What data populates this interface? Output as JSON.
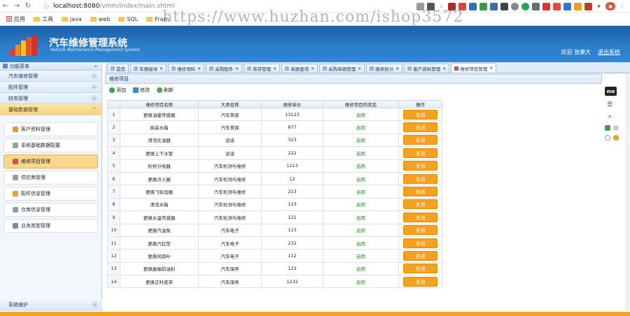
{
  "browser": {
    "url_host": "localhost:8080",
    "url_path": "/vmm/index/main.shtml",
    "bookmarks": [
      "应用",
      "工具",
      "java",
      "web",
      "SQL",
      "Fram"
    ]
  },
  "watermark": "https://www.huzhan.com/ishop3572",
  "header": {
    "title": "汽车维修管理系统",
    "subtitle": "Vehicle Maintenance Management System",
    "greeting": "欢迎 张康大",
    "logout": "退出系统",
    "brand_color": "#2a7fcd"
  },
  "sidebar": {
    "header": "功能菜单",
    "sections": [
      {
        "label": "汽车维修管理"
      },
      {
        "label": "配件管理"
      },
      {
        "label": "财务管理"
      },
      {
        "label": "基础数据管理"
      }
    ],
    "items": [
      {
        "label": "客户资料管理",
        "icon": "user-icon"
      },
      {
        "label": "系统基础数据配置",
        "icon": "config-icon"
      },
      {
        "label": "维修项目管理",
        "icon": "repair-icon"
      },
      {
        "label": "供应商管理",
        "icon": "supplier-icon"
      },
      {
        "label": "配件信息管理",
        "icon": "parts-icon"
      },
      {
        "label": "仓库信息管理",
        "icon": "warehouse-icon"
      },
      {
        "label": "业务类型管理",
        "icon": "business-icon"
      }
    ],
    "bottom_section": "系统维护"
  },
  "tabs": [
    {
      "label": "首页"
    },
    {
      "label": "车辆接待"
    },
    {
      "label": "维修领料"
    },
    {
      "label": "采购配件"
    },
    {
      "label": "库存管理"
    },
    {
      "label": "单据查询"
    },
    {
      "label": "采购单据管理"
    },
    {
      "label": "报表统计"
    },
    {
      "label": "客户资料管理"
    },
    {
      "label": "维修项目管理"
    }
  ],
  "panel": {
    "title": "维修项目",
    "toolbar": {
      "add": "添加",
      "edit": "修改",
      "refresh": "刷新"
    }
  },
  "table": {
    "headers": [
      "维修项目名称",
      "大类名称",
      "维修单价",
      "维修项目的状态",
      "操作"
    ],
    "action_label": "关闭",
    "rows": [
      {
        "no": "1",
        "name": "更换油量传感器",
        "category": "汽车美容",
        "price": "13123",
        "status": "启用"
      },
      {
        "no": "2",
        "name": "拆装水箱",
        "category": "汽车美容",
        "price": "877",
        "status": "启用"
      },
      {
        "no": "3",
        "name": "清洗化油器",
        "category": "谈谈",
        "price": "323",
        "status": "启用"
      },
      {
        "no": "4",
        "name": "更换上下水管",
        "category": "谈谈",
        "price": "222",
        "status": "启用"
      },
      {
        "no": "5",
        "name": "检修分电器",
        "category": "汽车检测与维修",
        "price": "1213",
        "status": "启用"
      },
      {
        "no": "6",
        "name": "更换点火圈",
        "category": "汽车检测与维修",
        "price": "12",
        "status": "启用"
      },
      {
        "no": "7",
        "name": "更换飞轮齿圈",
        "category": "汽车检测与维修",
        "price": "213",
        "status": "启用"
      },
      {
        "no": "8",
        "name": "清洗水箱",
        "category": "汽车检测与维修",
        "price": "123",
        "status": "启用"
      },
      {
        "no": "9",
        "name": "更换水温传感器",
        "category": "汽车检测与维修",
        "price": "121",
        "status": "启用"
      },
      {
        "no": "10",
        "name": "更换汽油泵",
        "category": "汽车电子",
        "price": "123",
        "status": "启用"
      },
      {
        "no": "11",
        "name": "更换汽缸垫",
        "category": "汽车电子",
        "price": "232",
        "status": "启用"
      },
      {
        "no": "12",
        "name": "更换风扇叶",
        "category": "汽车电子",
        "price": "112",
        "status": "启用"
      },
      {
        "no": "13",
        "name": "更换曲轴前油封",
        "category": "汽车保养",
        "price": "123",
        "status": "启用"
      },
      {
        "no": "14",
        "name": "更换正时皮带",
        "category": "汽车保养",
        "price": "1232",
        "status": "启用"
      }
    ]
  },
  "float_tools": {
    "badge": "me"
  }
}
